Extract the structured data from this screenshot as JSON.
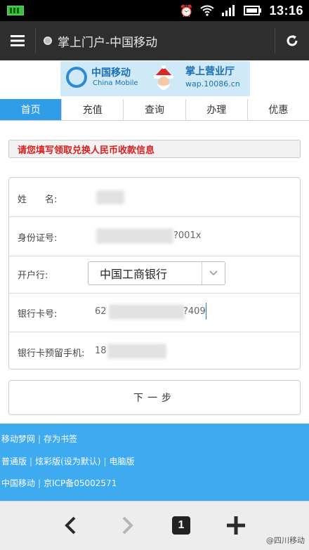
{
  "status_bar": {
    "time": "13:16"
  },
  "browser": {
    "page_title": "掌上门户-中国移动"
  },
  "banner": {
    "brand_cn": "中国移动",
    "brand_en": "China Mobile",
    "hall": "掌上营业厅",
    "site": "wap.10086.cn"
  },
  "tabs": [
    {
      "label": "首页",
      "active": true
    },
    {
      "label": "充值",
      "active": false
    },
    {
      "label": "查询",
      "active": false
    },
    {
      "label": "办理",
      "active": false
    },
    {
      "label": "优惠",
      "active": false
    }
  ],
  "notice": "请您填写领取兑换人民币收款信息",
  "form": {
    "name_label": "姓　　名:",
    "id_label": "身份证号:",
    "id_value_visible": "?001x",
    "bank_label": "开户行:",
    "bank_selected": "中国工商银行",
    "card_label": "银行卡号:",
    "card_prefix": "62",
    "card_suffix": "?409",
    "phone_label": "银行卡预留手机:",
    "phone_prefix": "18"
  },
  "next_button": "下一步",
  "footer": {
    "line1": [
      "移动梦网",
      "存为书签"
    ],
    "line2": [
      "普通版",
      "炫彩版(设为默认)",
      "电脑版"
    ],
    "line3": [
      "中国移动",
      "京ICP备05002571"
    ]
  },
  "toolbar": {
    "tab_count": "1"
  },
  "watermark": "@四川移动",
  "colors": {
    "accent": "#2f9de8",
    "footer_bg": "#3eaaf0",
    "notice_text": "#d81e1e"
  }
}
